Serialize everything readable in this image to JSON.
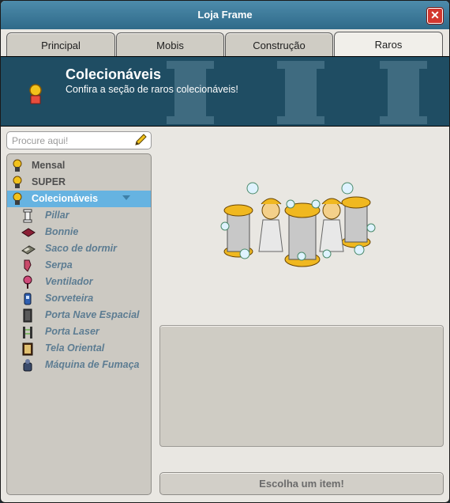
{
  "window": {
    "title": "Loja Frame"
  },
  "tabs": [
    {
      "label": "Principal",
      "active": false
    },
    {
      "label": "Mobis",
      "active": false
    },
    {
      "label": "Construção",
      "active": false
    },
    {
      "label": "Raros",
      "active": true
    }
  ],
  "banner": {
    "title": "Colecionáveis",
    "subtitle": "Confira a seção de raros colecionáveis!"
  },
  "search": {
    "placeholder": "Procure aqui!",
    "icon": "pencil-icon"
  },
  "categories": [
    {
      "label": "Mensal",
      "selected": false,
      "icon": "medal-icon"
    },
    {
      "label": "SUPER",
      "selected": false,
      "icon": "medal-icon"
    },
    {
      "label": "Colecionáveis",
      "selected": true,
      "icon": "medal-icon"
    }
  ],
  "subcategories": [
    {
      "label": "Pillar",
      "icon": "pillar-icon"
    },
    {
      "label": "Bonnie",
      "icon": "bonnie-icon"
    },
    {
      "label": "Saco de dormir",
      "icon": "sleeping-bag-icon"
    },
    {
      "label": "Serpa",
      "icon": "serpa-icon"
    },
    {
      "label": "Ventilador",
      "icon": "fan-icon"
    },
    {
      "label": "Sorveteira",
      "icon": "ice-cream-machine-icon"
    },
    {
      "label": "Porta Nave Espacial",
      "icon": "space-door-icon"
    },
    {
      "label": "Porta Laser",
      "icon": "laser-door-icon"
    },
    {
      "label": "Tela Oriental",
      "icon": "oriental-screen-icon"
    },
    {
      "label": "Máquina de Fumaça",
      "icon": "smoke-machine-icon"
    }
  ],
  "action": {
    "label": "Escolha um item!"
  },
  "colors": {
    "titlebar": "#3d7b9b",
    "banner": "#1f4d63",
    "selected": "#66b3e1",
    "subcategory_text": "#5c7c92",
    "close": "#d2372f"
  }
}
